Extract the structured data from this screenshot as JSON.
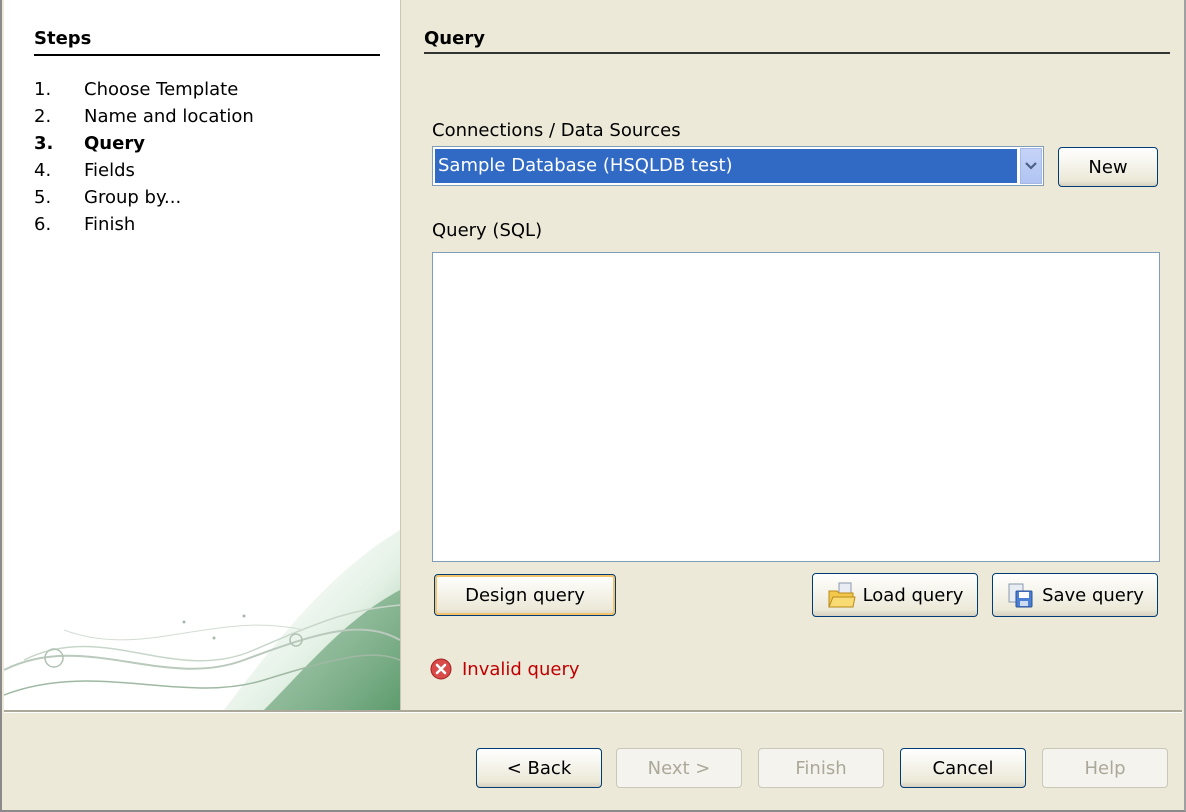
{
  "steps": {
    "title": "Steps",
    "items": [
      {
        "num": "1.",
        "label": "Choose Template",
        "active": false
      },
      {
        "num": "2.",
        "label": "Name and location",
        "active": false
      },
      {
        "num": "3.",
        "label": "Query",
        "active": true
      },
      {
        "num": "4.",
        "label": "Fields",
        "active": false
      },
      {
        "num": "5.",
        "label": "Group by...",
        "active": false
      },
      {
        "num": "6.",
        "label": "Finish",
        "active": false
      }
    ]
  },
  "content": {
    "title": "Query",
    "connections_label": "Connections / Data Sources",
    "connection_selected": "Sample Database (HSQLDB test)",
    "new_button": "New",
    "query_label": "Query (SQL)",
    "query_value": "",
    "design_query_button": "Design query",
    "load_query_button": "Load query",
    "save_query_button": "Save query",
    "status_message": "Invalid query"
  },
  "footer": {
    "back_button": "< Back",
    "next_button": "Next >",
    "finish_button": "Finish",
    "cancel_button": "Cancel",
    "help_button": "Help"
  },
  "colors": {
    "selection": "#316ac5",
    "error": "#c00000",
    "panel_bg": "#ece9d8"
  }
}
